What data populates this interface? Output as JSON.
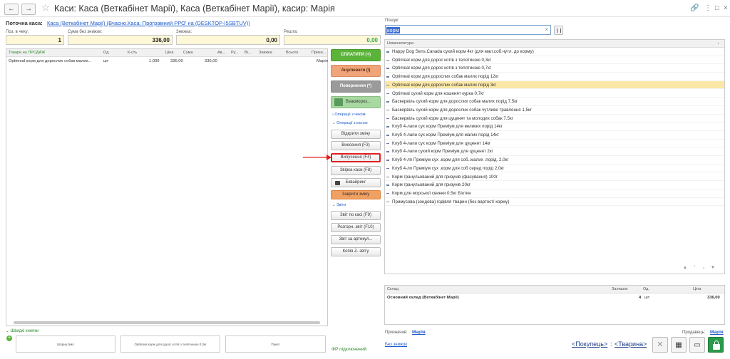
{
  "window": {
    "title": "Каси: Каса (Веткабінет Марії), Каса (Веткабінет Марії), касир: Марія"
  },
  "header": {
    "current_cash_label": "Поточна каса:",
    "current_cash_value": "Каса (Веткабінет Марії) (Вчасно.Каса: Програмний РРО' на (DESKTOP-I5SBTUV))"
  },
  "totals": {
    "pos_label": "Поз. в чеку:",
    "pos_value": "1",
    "sum_label": "Сума без знижок:",
    "sum_value": "336,00",
    "discount_label": "Знижка:",
    "discount_value": "0,00",
    "change_label": "Решта:",
    "change_value": "0,00"
  },
  "goods": {
    "columns": [
      "Товари на ПРОДАЖ",
      "Од.",
      "К-сть",
      "Ціна",
      "Сума",
      "Ав...",
      "Ру...",
      "Ві...",
      "Знижка",
      "Всього",
      "Призн..."
    ],
    "rows": [
      {
        "name": "Optimeal корм для дорослих собак малих...",
        "unit": "шт",
        "qty": "1,000",
        "price": "336,00",
        "sum": "336,00",
        "purpose": "Марія"
      }
    ]
  },
  "actions": {
    "pay": "СПЛАТИТИ (+)",
    "cancel": "Анулювати (/)",
    "return": "Повернення (*)",
    "mutual": "Взаємороз...",
    "section_check_ops": "Операції з чеком",
    "section_cash_ops": "Операції з касою",
    "open_shift": "Відкрити зміну",
    "deposit": "Внесення (F3)",
    "withdraw": "Вилучення (F4)",
    "reconcile": "Звірка каси (F8)",
    "acquiring": "Еквайринг",
    "close_shift": "Закрити зміну",
    "section_reports": "Звіти",
    "report_cash": "Звіт по касі (F9)",
    "detailed_report": "Розгорн. звіт (F10)",
    "report_by_article": "Звіт за артикул...",
    "z_copy": "Копія Z- звіту",
    "fr_connected": "ФР підключений"
  },
  "search": {
    "label": "Пошук:",
    "value": "корм"
  },
  "nomenclature": {
    "header": "Номенклатура",
    "items": [
      "Happy Dog Sens.Canada сухий корм 4кг  (для мал.соб.чутл. до корму)",
      "Optimeal корм для дорос котів з телятиною 0,3кг",
      "Optimeal корм для дорос котів з телятиною 0,7кг",
      "Optimeal корм для дорослих собак малих порід 12кг",
      "Optimeal корм для дорослих собак малих порід 3кг",
      "Optimeal сухий корм для кошенят курка 0,7кг",
      "Баскервіль сухий корм для дорослих собак малих порід 7,5кг",
      "Баскервіль сухий корм для дорослих собак чутливе травлення 1,5кг",
      "Баскервіль сухий корм для цуценят та молодих собак 7,5кг",
      "Клуб 4-лапи сух корм Преміум для великих порід 14кг",
      "Клуб 4-лапи сух корм Преміум для малих порід 14кг",
      "Клуб 4-лапи сух корм Преміум для цуценят 14кг",
      "Клуб 4-лапи сухий корм Преміум для цуценят 2кг",
      "Клуб 4-лп Преміум сух .корм для соб..малих .порід. 2,0кг",
      "Клуб 4-лп Преміум сух .корм для соб серед порід  2,0кг",
      "Корм гранульований для гризунів (фасування) 100г",
      "Корм гранульований для гризунів 20кг",
      "Корм для морської свинки 0,5кг Біотин",
      "Примусова (зондова) годівля тварин (без вартості корму)"
    ],
    "selected_index": 4
  },
  "stock": {
    "columns": [
      "Склад",
      "Залишок",
      "Од.",
      "Ціна"
    ],
    "rows": [
      {
        "warehouse": "Основний оклад (Веткабінет Марії)",
        "qty": "4",
        "unit": "шт",
        "price": "336,00"
      }
    ]
  },
  "footer": {
    "assigned_label": "Призначив:",
    "assigned_value": "Марія",
    "seller_label": "Продавець:",
    "seller_value": "Марія",
    "no_discount": "Без знижок",
    "buyer_link": "<Покупець>",
    "separator": ":",
    "animal_link": "<Тварина>",
    "quick_buttons_label": "Швидкі кнопки",
    "quick_buttons": [
      "Шприц 5мл",
      "Optimeal корм для дорос котів з телятиною 0,3кг",
      "Пакет"
    ]
  },
  "colors": {
    "pay": "#5bb33a",
    "cancel": "#f0a47a",
    "return": "#9a9a9a",
    "accent_selected": "#fbe8a6",
    "highlight_red": "#e02020"
  }
}
